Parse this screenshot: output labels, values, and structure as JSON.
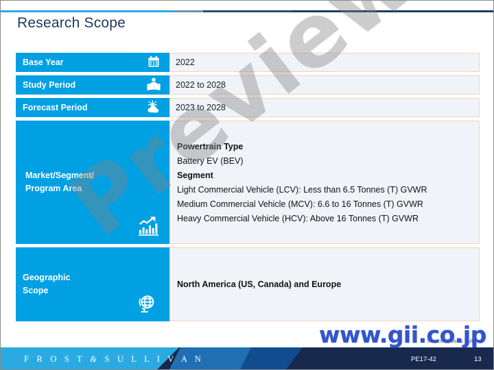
{
  "slide": {
    "title": "Research Scope"
  },
  "table": {
    "rows": [
      {
        "label": "Base Year",
        "icon": "calendar-icon",
        "value": "2022"
      },
      {
        "label": "Study Period",
        "icon": "reader-icon",
        "value": "2022 to 2028"
      },
      {
        "label": "Forecast Period",
        "icon": "weather-sun-cloud-icon",
        "value": "2023 to 2028"
      }
    ],
    "market_row": {
      "label_line1": "Market/Segment/",
      "label_line2": "Program Area",
      "icon": "bar-chart-trend-icon",
      "content": {
        "powertrain_heading": "Powertrain Type",
        "powertrain_value": "Battery EV (BEV)",
        "segment_heading": "Segment",
        "segments": [
          "Light Commercial Vehicle (LCV): Less than 6.5 Tonnes (T) GVWR",
          "Medium Commercial Vehicle (MCV): 6.6 to 16 Tonnes (T) GVWR",
          "Heavy Commercial Vehicle (HCV): Above 16 Tonnes (T) GVWR"
        ]
      }
    },
    "geo_row": {
      "label_line1": "Geographic",
      "label_line2": "Scope",
      "icon": "globe-stand-icon",
      "value": "North America (US, Canada) and Europe"
    }
  },
  "watermark": {
    "preview_text": "Preview",
    "site_text": "www.gii.co.jp"
  },
  "source_note": "Source: Frost & Sullivan",
  "footer": {
    "brand_first": "F R O S T",
    "brand_amp": "&",
    "brand_last": "S U L L I V A N",
    "code": "PE17-42",
    "page": "13"
  },
  "colors": {
    "accent_blue": "#00A0E3",
    "title_navy": "#1F3864",
    "cell_bg": "#F0F4F8",
    "cell_border": "#F4D2C0",
    "footer_navy": "#17294D",
    "gii_blue": "#3355CC"
  }
}
